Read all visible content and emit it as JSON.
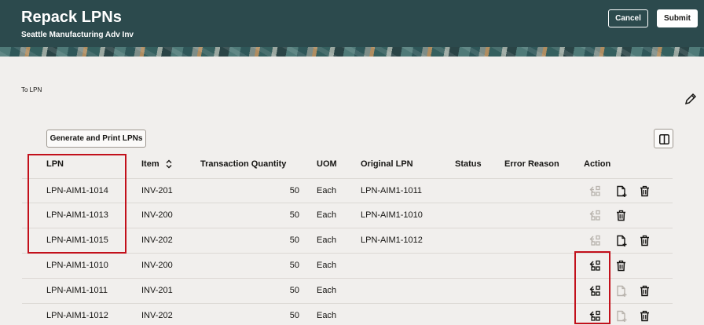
{
  "header": {
    "title": "Repack LPNs",
    "subtitle": "Seattle Manufacturing Adv Inv",
    "cancel_label": "Cancel",
    "submit_label": "Submit"
  },
  "form": {
    "to_lpn_label": "To LPN"
  },
  "toolbar": {
    "generate_label": "Generate and Print LPNs"
  },
  "table": {
    "columns": [
      "LPN",
      "Item",
      "Transaction Quantity",
      "UOM",
      "Original LPN",
      "Status",
      "Error Reason",
      "Action"
    ],
    "rows": [
      {
        "lpn": "LPN-AIM1-1014",
        "item": "INV-201",
        "qty": "50",
        "uom": "Each",
        "original_lpn": "LPN-AIM1-1011",
        "status": "",
        "error": "",
        "actions": [
          "unpack-disabled",
          "document",
          "delete"
        ]
      },
      {
        "lpn": "LPN-AIM1-1013",
        "item": "INV-200",
        "qty": "50",
        "uom": "Each",
        "original_lpn": "LPN-AIM1-1010",
        "status": "",
        "error": "",
        "actions": [
          "unpack-disabled",
          "delete"
        ]
      },
      {
        "lpn": "LPN-AIM1-1015",
        "item": "INV-202",
        "qty": "50",
        "uom": "Each",
        "original_lpn": "LPN-AIM1-1012",
        "status": "",
        "error": "",
        "actions": [
          "unpack-disabled",
          "document",
          "delete"
        ]
      },
      {
        "lpn": "LPN-AIM1-1010",
        "item": "INV-200",
        "qty": "50",
        "uom": "Each",
        "original_lpn": "",
        "status": "",
        "error": "",
        "actions": [
          "unpack",
          "delete"
        ]
      },
      {
        "lpn": "LPN-AIM1-1011",
        "item": "INV-201",
        "qty": "50",
        "uom": "Each",
        "original_lpn": "",
        "status": "",
        "error": "",
        "actions": [
          "unpack",
          "document-disabled",
          "delete"
        ]
      },
      {
        "lpn": "LPN-AIM1-1012",
        "item": "INV-202",
        "qty": "50",
        "uom": "Each",
        "original_lpn": "",
        "status": "",
        "error": "",
        "actions": [
          "unpack",
          "document-disabled",
          "delete"
        ]
      }
    ]
  },
  "icons": {
    "pencil": "pencil-icon",
    "columns": "columns-icon",
    "sort": "sort-icon",
    "unpack": "unpack-icon",
    "document": "document-add-icon",
    "delete": "trash-icon"
  },
  "colors": {
    "header_bg": "#2c4a4d",
    "page_bg": "#f1efed",
    "highlight": "#c2101b"
  }
}
